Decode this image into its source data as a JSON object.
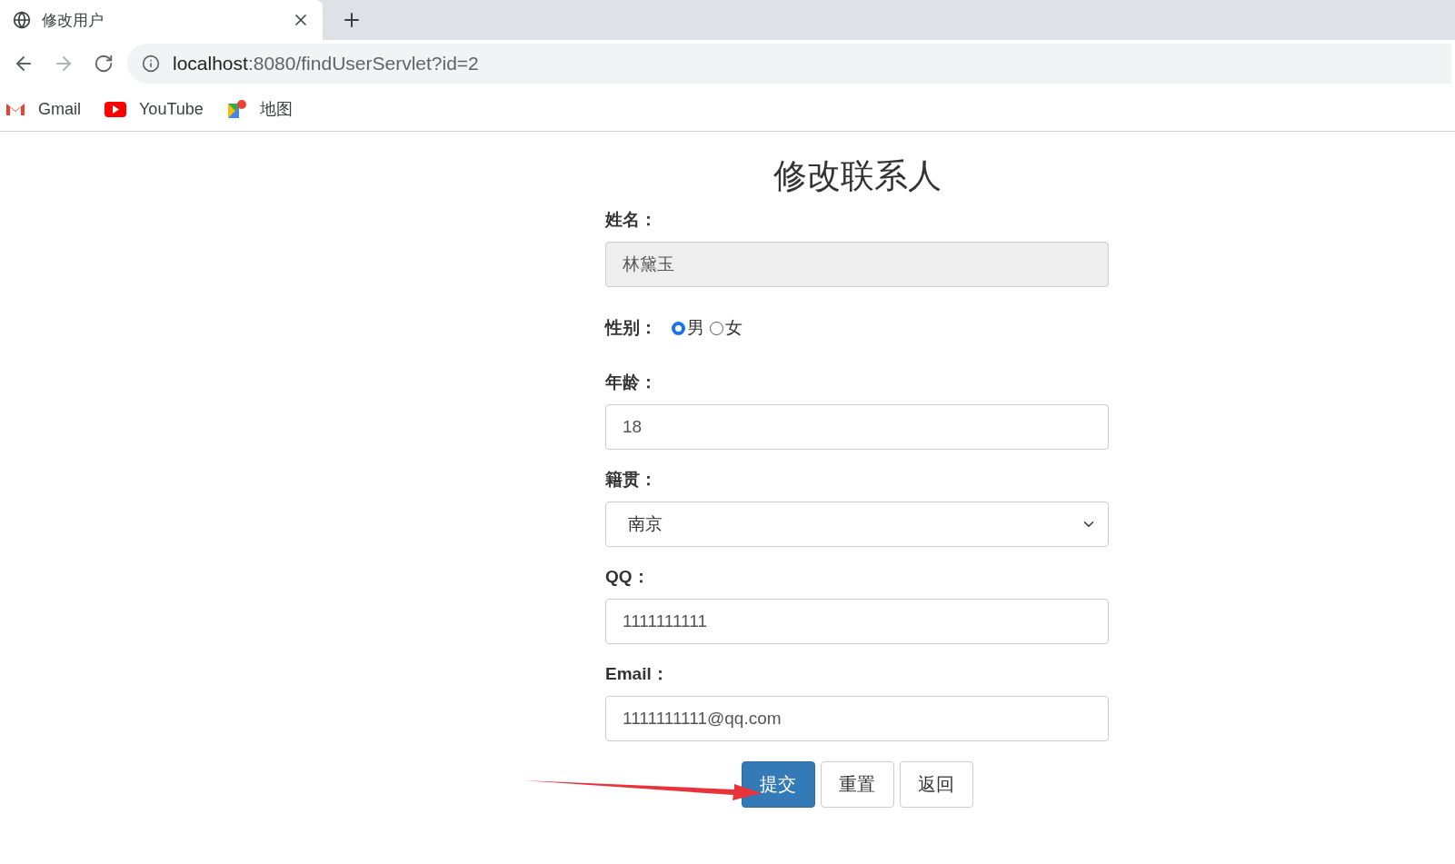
{
  "browser": {
    "tab": {
      "title": "修改用户"
    },
    "address": {
      "host": "localhost",
      "path": ":8080/findUserServlet?id=2"
    },
    "bookmarks": [
      {
        "kind": "gmail",
        "label": "Gmail"
      },
      {
        "kind": "youtube",
        "label": "YouTube"
      },
      {
        "kind": "maps",
        "label": "地图"
      }
    ]
  },
  "form": {
    "title": "修改联系人",
    "fields": [
      {
        "kind": "text",
        "label": "姓名：",
        "value": "林黛玉",
        "disabled": true
      },
      {
        "kind": "radio",
        "label": "性别：",
        "options": [
          {
            "label": "男",
            "selected": true
          },
          {
            "label": "女",
            "selected": false
          }
        ]
      },
      {
        "kind": "text",
        "label": "年龄：",
        "value": "18",
        "disabled": false
      },
      {
        "kind": "select",
        "label": "籍贯：",
        "value": "南京"
      },
      {
        "kind": "text",
        "label": "QQ：",
        "value": "1111111111",
        "disabled": false
      },
      {
        "kind": "text",
        "label": "Email：",
        "value": "1111111111@qq.com",
        "disabled": false
      }
    ],
    "buttons": [
      {
        "label": "提交",
        "primary": true
      },
      {
        "label": "重置",
        "primary": false
      },
      {
        "label": "返回",
        "primary": false
      }
    ]
  }
}
